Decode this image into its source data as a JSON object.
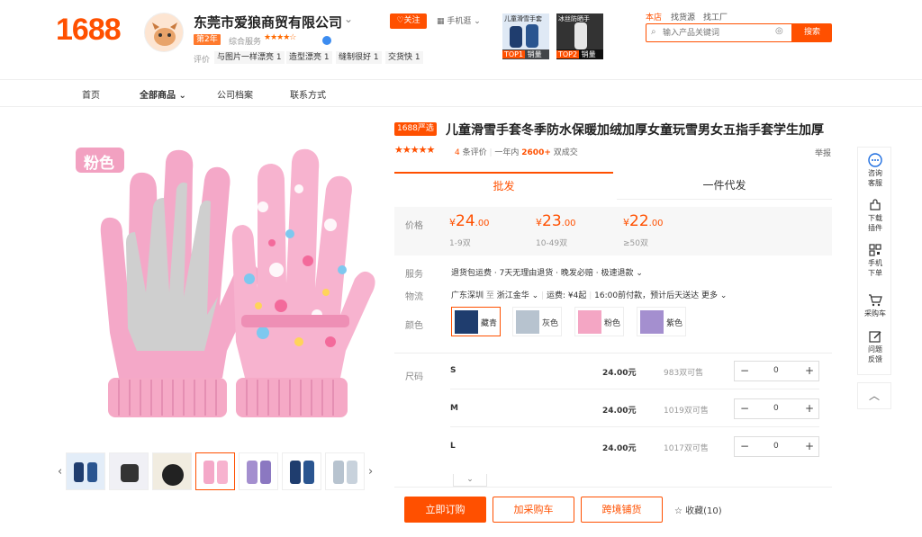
{
  "header": {
    "logo": "1688",
    "shop_name": "东莞市爱狼商贸有限公司",
    "years_badge": "第2年",
    "rating_label": "综合服务",
    "rating_stars": "★★★★☆",
    "review_label": "评价",
    "review_tags": [
      "与图片一样漂亮 1",
      "造型漂亮 1",
      "缝制很好 1",
      "交货快 1"
    ],
    "follow_label": "关注",
    "mobile_label": "手机逛",
    "ads": [
      {
        "caption": "儿童滑雪手套",
        "rank": "TOP1",
        "tag": "销量"
      },
      {
        "caption": "冰丝防晒手",
        "rank": "TOP2",
        "tag": "销量"
      }
    ],
    "search_tabs": [
      "本店",
      "找货源",
      "找工厂"
    ],
    "search_placeholder": "输入产品关键词",
    "search_button": "搜索"
  },
  "nav": {
    "items": [
      "首页",
      "全部商品",
      "公司档案",
      "联系方式"
    ]
  },
  "product": {
    "image_tag": "粉色",
    "badge": "1688严选",
    "title": "儿童滑雪手套冬季防水保暖加绒加厚女童玩雪男女五指手套学生加厚",
    "stars": "★★★★★",
    "review_count": "4",
    "review_suffix": "条评价",
    "sales_prefix": "一年内",
    "sales_count": "2600+",
    "sales_suffix": "双成交",
    "report": "举报",
    "tabs": [
      "批发",
      "一件代发"
    ],
    "price_label": "价格",
    "prices": [
      {
        "currency": "¥",
        "int": "24",
        "dec": ".00",
        "range": "1-9双"
      },
      {
        "currency": "¥",
        "int": "23",
        "dec": ".00",
        "range": "10-49双"
      },
      {
        "currency": "¥",
        "int": "22",
        "dec": ".00",
        "range": "≥50双"
      }
    ],
    "service_label": "服务",
    "service_text": "退货包运费 · 7天无理由退货 · 晚发必赔 · 极速退款",
    "logistics_label": "物流",
    "logistics_from": "广东深圳",
    "logistics_to_word": "至",
    "logistics_to": "浙江金华",
    "logistics_fee": "运费: ¥4起",
    "logistics_time": "16:00前付款，预计后天送达",
    "logistics_more": "更多",
    "color_label": "颜色",
    "colors": [
      "藏青",
      "灰色",
      "粉色",
      "紫色"
    ],
    "size_label": "尺码",
    "sizes": [
      {
        "name": "S",
        "price": "24.00元",
        "stock": "983双可售",
        "qty": "0"
      },
      {
        "name": "M",
        "price": "24.00元",
        "stock": "1019双可售",
        "qty": "0"
      },
      {
        "name": "L",
        "price": "24.00元",
        "stock": "1017双可售",
        "qty": "0"
      }
    ],
    "buy_button": "立即订购",
    "cart_button": "加采购车",
    "cross_button": "跨境铺货",
    "favorite": "收藏(10)"
  },
  "rail": {
    "items": [
      "咨询客服",
      "下载插件",
      "手机下单",
      "采购车",
      "问题反馈"
    ]
  },
  "colors": {
    "brand": "#ff5000",
    "swatch_navy": "#1f3d6e",
    "swatch_gray": "#b7c3cf",
    "swatch_pink": "#f4a6c4",
    "swatch_purple": "#a48fcf"
  }
}
